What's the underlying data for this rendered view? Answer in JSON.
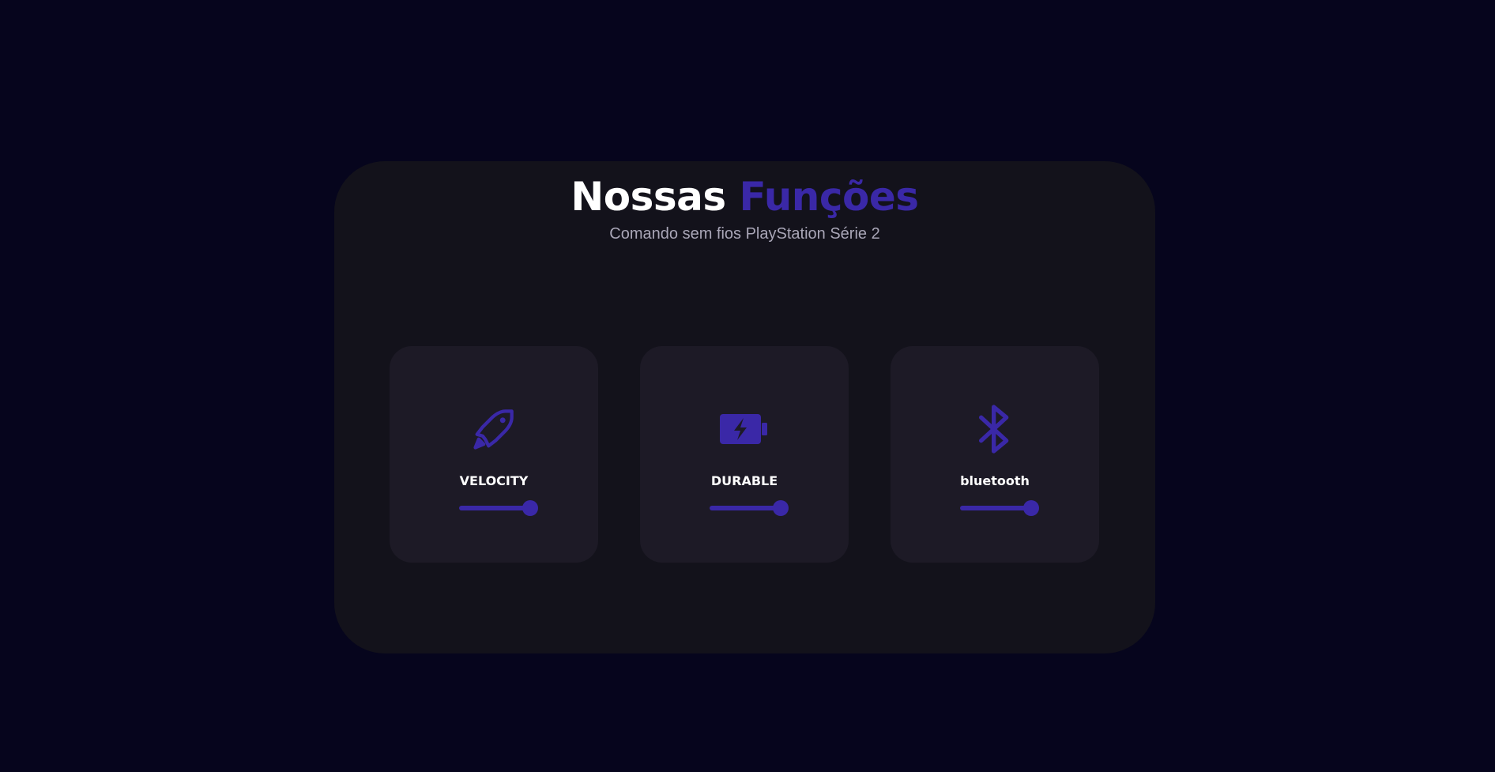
{
  "heading": {
    "word1": "Nossas",
    "word2": "Funções"
  },
  "subtitle": "Comando sem fios PlayStation Série 2",
  "colors": {
    "background": "#06051d",
    "panel": "#13121b",
    "card": "#1d1a26",
    "accent": "#3a28a7",
    "text": "#ffffff",
    "subtext": "#a9a6b7"
  },
  "features": [
    {
      "label": "VELOCITY",
      "icon": "rocket-icon",
      "level": 0.9
    },
    {
      "label": "DURABLE",
      "icon": "battery-charging-icon",
      "level": 0.9
    },
    {
      "label": "bluetooth",
      "icon": "bluetooth-icon",
      "level": 0.9
    }
  ]
}
